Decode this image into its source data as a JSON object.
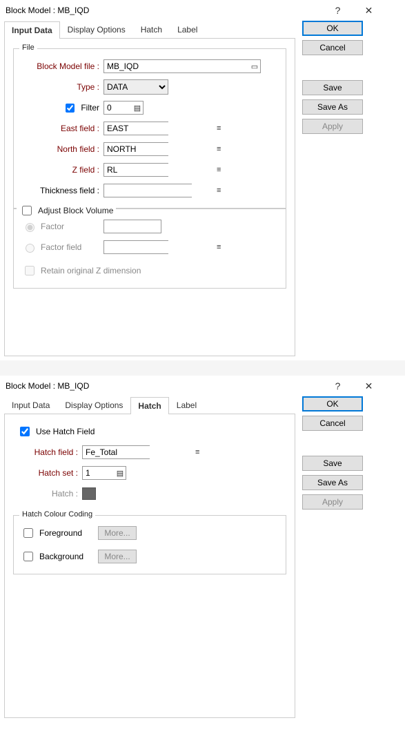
{
  "dialog1": {
    "title": "Block Model : MB_IQD",
    "help_glyph": "?",
    "close_glyph": "✕",
    "tabs": [
      "Input Data",
      "Display Options",
      "Hatch",
      "Label"
    ],
    "active_tab": "Input Data",
    "buttons": {
      "ok": "OK",
      "cancel": "Cancel",
      "save": "Save",
      "saveas": "Save As",
      "apply": "Apply"
    },
    "file_group": {
      "legend": "File",
      "block_model_file": {
        "label": "Block Model file :",
        "value": "MB_IQD"
      },
      "type": {
        "label": "Type :",
        "value": "DATA"
      },
      "filter": {
        "label": "Filter",
        "checked": true,
        "value": "0"
      },
      "east_field": {
        "label": "East field :",
        "value": "EAST"
      },
      "north_field": {
        "label": "North field :",
        "value": "NORTH"
      },
      "z_field": {
        "label": "Z field :",
        "value": "RL"
      },
      "thickness_field": {
        "label": "Thickness field :",
        "value": ""
      }
    },
    "adjust_group": {
      "label": "Adjust Block Volume",
      "checked": false,
      "factor": {
        "label": "Factor",
        "selected": true,
        "value": ""
      },
      "factor_field": {
        "label": "Factor field",
        "selected": false,
        "value": ""
      },
      "retain": {
        "label": "Retain original Z dimension",
        "checked": false
      }
    }
  },
  "dialog2": {
    "title": "Block Model : MB_IQD",
    "help_glyph": "?",
    "close_glyph": "✕",
    "tabs": [
      "Input Data",
      "Display Options",
      "Hatch",
      "Label"
    ],
    "active_tab": "Hatch",
    "buttons": {
      "ok": "OK",
      "cancel": "Cancel",
      "save": "Save",
      "saveas": "Save As",
      "apply": "Apply"
    },
    "hatch_top": {
      "use_hatch_field": {
        "label": "Use Hatch Field",
        "checked": true
      },
      "hatch_field": {
        "label": "Hatch field :",
        "value": "Fe_Total"
      },
      "hatch_set": {
        "label": "Hatch set :",
        "value": "1"
      },
      "hatch": {
        "label": "Hatch :"
      }
    },
    "colour_group": {
      "legend": "Hatch Colour Coding",
      "foreground": {
        "label": "Foreground",
        "checked": false,
        "more": "More..."
      },
      "background": {
        "label": "Background",
        "checked": false,
        "more": "More..."
      }
    }
  }
}
